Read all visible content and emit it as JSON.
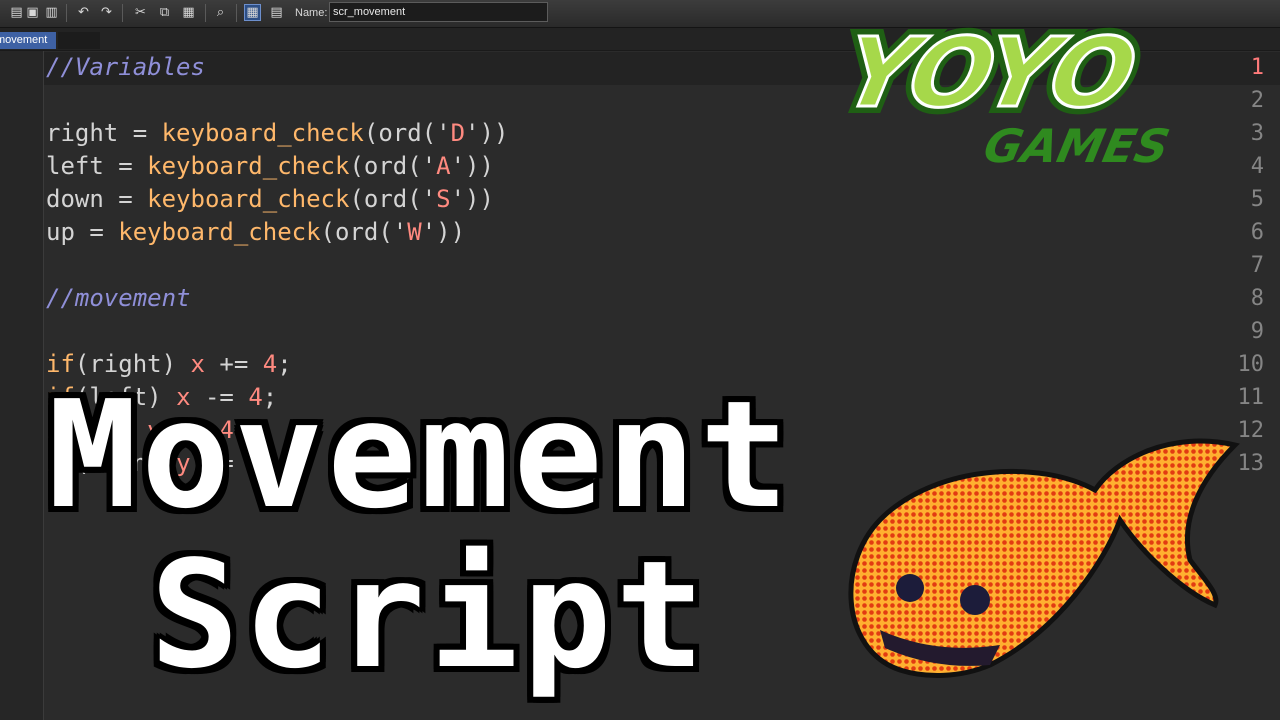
{
  "toolbar": {
    "icons": [
      "new-icon",
      "save-icon",
      "save-as-icon",
      "undo-icon",
      "redo-icon",
      "cut-icon",
      "copy-icon",
      "paste-icon",
      "find-icon",
      "grid-icon",
      "properties-icon"
    ],
    "name_label": "Name:",
    "name_value": "scr_movement"
  },
  "tabs": [
    {
      "label": "movement",
      "active": true
    }
  ],
  "editor": {
    "lines": [
      {
        "n": "1",
        "text": "//Variables"
      },
      {
        "n": "2",
        "text": ""
      },
      {
        "n": "3",
        "text": "right = keyboard_check(ord('D'))"
      },
      {
        "n": "4",
        "text": "left = keyboard_check(ord('A'))"
      },
      {
        "n": "5",
        "text": "down = keyboard_check(ord('S'))"
      },
      {
        "n": "6",
        "text": "up = keyboard_check(ord('W'))"
      },
      {
        "n": "7",
        "text": ""
      },
      {
        "n": "8",
        "text": "//movement"
      },
      {
        "n": "9",
        "text": ""
      },
      {
        "n": "10",
        "text": "if(right) x += 4;"
      },
      {
        "n": "11",
        "text": "if(left) x -= 4;"
      },
      {
        "n": "12",
        "text": "if(up) y -= 4;"
      },
      {
        "n": "13",
        "text": "if(down) y += 4;"
      }
    ],
    "current_line": 1
  },
  "logo": {
    "top": "YOYO",
    "bottom": "GAMES",
    "green": "#8cc63f",
    "dark_green": "#2e7d1e"
  },
  "title": {
    "line1": "Movement",
    "line2": "Script"
  },
  "colors": {
    "comment": "#8f8fd8",
    "function": "#ffb86b",
    "string": "#ff8a80",
    "background": "#2b2b2b"
  }
}
